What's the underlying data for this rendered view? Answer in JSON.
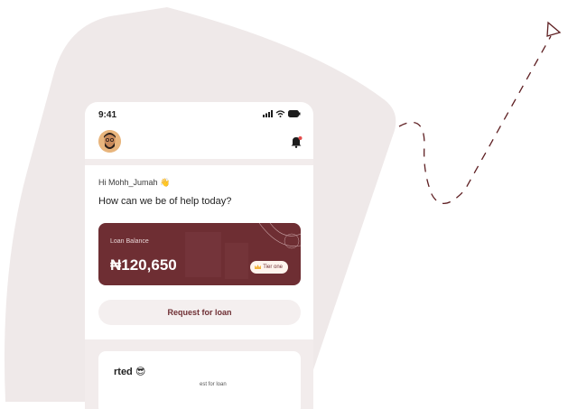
{
  "status_bar": {
    "time": "9:41"
  },
  "header": {
    "avatar_icon": "avatar-icon",
    "bell_icon": "bell-icon"
  },
  "greeting": {
    "hello": "Hi Mohh_Jumah 👋",
    "question": "How can we be of help today?"
  },
  "loan_card": {
    "label": "Loan Balance",
    "amount": "₦120,650",
    "tier": "Tier one",
    "color": "#6e2e33"
  },
  "actions": {
    "request_label": "Request for loan"
  },
  "get_started": {
    "title": "rted 😎",
    "subtitle": "est for loan"
  },
  "colors": {
    "blob": "#efe9e9",
    "accent": "#6e2e33",
    "dash": "#5e1f22"
  }
}
